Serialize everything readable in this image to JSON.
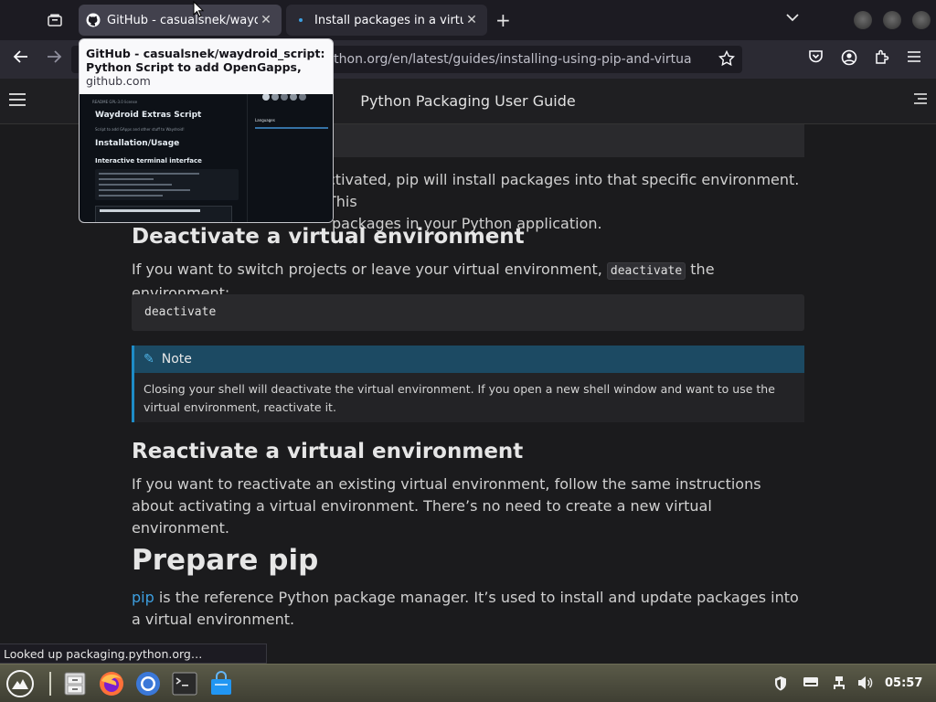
{
  "browser": {
    "tabs": [
      {
        "title": "GitHub - casualsnek/waydroid_",
        "active": true,
        "favicon": "github-icon"
      },
      {
        "title": "Install packages in a virtual e",
        "active": false,
        "favicon": "python-icon"
      }
    ],
    "url": "packaging.python.org/en/latest/guides/installing-using-pip-and-virtual-environ",
    "url_visible": "python.org/en/latest/guides/installing-using-pip-and-virtual-environ",
    "tooltip": {
      "title": "GitHub - casualsnek/waydroid_script: Python Script to add OpenGapps, Magis…",
      "domain": "github.com",
      "preview": {
        "section_tabs": "README    GPL-3.0 license",
        "heading1": "Waydroid Extras Script",
        "subtitle": "Script to add GApps and other stuff to Waydroid!",
        "heading2": "Installation/Usage",
        "heading3": "Interactive terminal interface",
        "sidebar_label": "Languages"
      }
    },
    "status_text": "Looked up packaging.python.org…"
  },
  "site": {
    "title": "Python Packaging User Guide"
  },
  "content": {
    "intro_para_line1_tail": "ctivated, pip will install packages into that specific environment. This",
    "intro_para_line2_tail": "packages in your Python application.",
    "h_deactivate": "Deactivate a virtual environment",
    "deactivate_para_before": "If you want to switch projects or leave your virtual environment, ",
    "deactivate_code_inline": "deactivate",
    "deactivate_para_after": " the environment:",
    "deactivate_code_block": "deactivate",
    "note_title": "Note",
    "note_body": "Closing your shell will deactivate the virtual environment. If you open a new shell window and want to use the virtual environment, reactivate it.",
    "h_reactivate": "Reactivate a virtual environment",
    "reactivate_para": "If you want to reactivate an existing virtual environment, follow the same instructions about activating a virtual environment. There’s no need to create a new virtual environment.",
    "h_prepare_pip": "Prepare pip",
    "pip_link": "pip",
    "pip_para": " is the reference Python package manager. It’s used to install and update packages into a virtual environment."
  },
  "taskbar": {
    "apps": [
      "zorin-menu-icon",
      "files-icon",
      "firefox-icon",
      "chromium-icon",
      "terminal-icon",
      "software-store-icon"
    ],
    "clock": "05:57"
  }
}
